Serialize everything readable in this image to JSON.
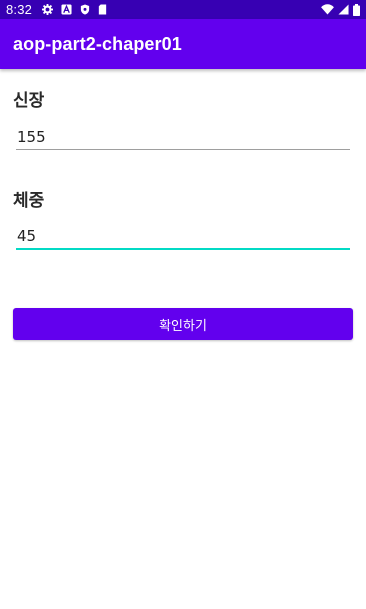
{
  "status_bar": {
    "time": "8:32",
    "left_icons": [
      "settings-icon",
      "a-icon",
      "shield-icon",
      "sd-card-icon"
    ],
    "right_icons": [
      "wifi-icon",
      "signal-icon",
      "battery-icon"
    ]
  },
  "app_bar": {
    "title": "aop-part2-chaper01"
  },
  "form": {
    "height_label": "신장",
    "height_value": "155",
    "weight_label": "체중",
    "weight_value": "45",
    "confirm_label": "확인하기"
  },
  "colors": {
    "status_bar": "#3700b3",
    "primary": "#6200ee",
    "accent": "#03dac5",
    "underline_inactive": "#9e9e9e"
  }
}
